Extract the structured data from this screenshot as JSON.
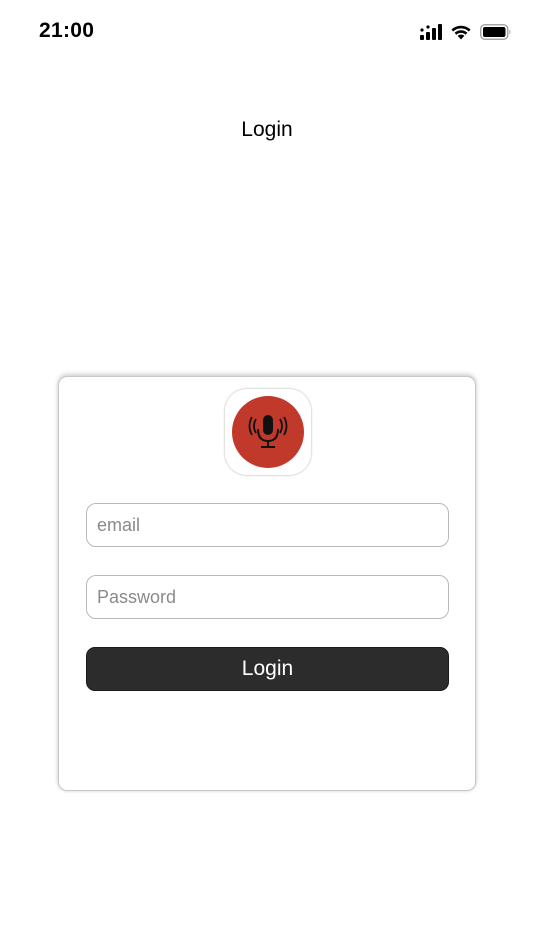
{
  "status_bar": {
    "time": "21:00",
    "icons": [
      "cellular-signal-icon",
      "wifi-icon",
      "battery-icon"
    ]
  },
  "nav": {
    "title": "Login"
  },
  "login_form": {
    "logo_icon": "microphone-icon",
    "email_placeholder": "email",
    "password_placeholder": "Password",
    "submit_label": "Login"
  },
  "colors": {
    "logo_red": "#c0392b",
    "button_dark": "#2c2c2c",
    "field_border": "#b9b9b9"
  }
}
